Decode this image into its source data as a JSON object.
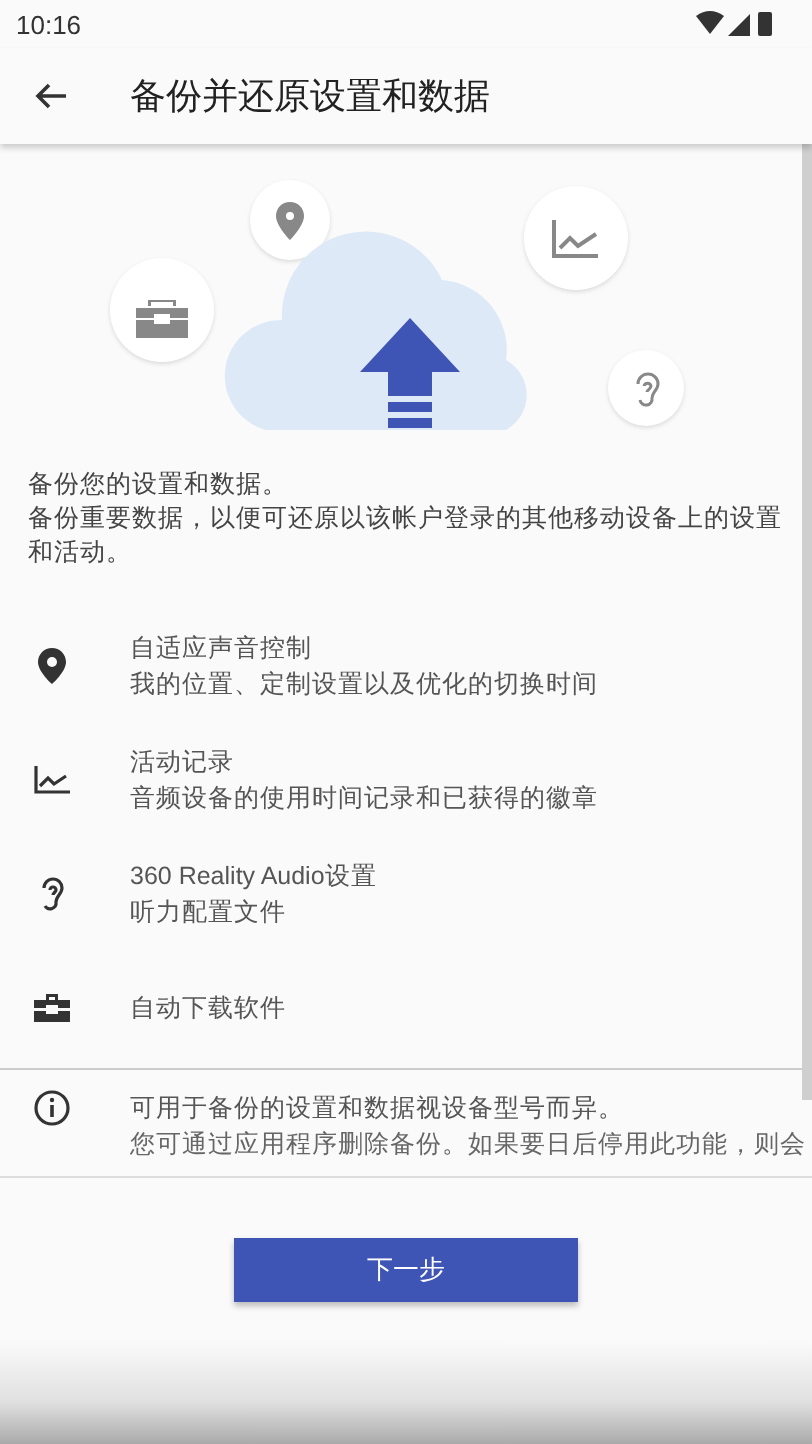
{
  "status_bar": {
    "time": "10:16"
  },
  "app_bar": {
    "title": "备份并还原设置和数据"
  },
  "intro": {
    "heading": "备份您的设置和数据。",
    "body": "备份重要数据，以便可还原以该帐户登录的其他移动设备上的设置和活动。"
  },
  "items": [
    {
      "kind": "location",
      "title": "自适应声音控制",
      "subtitle": "我的位置、定制设置以及优化的切换时间"
    },
    {
      "kind": "activity",
      "title": "活动记录",
      "subtitle": "音频设备的使用时间记录和已获得的徽章"
    },
    {
      "kind": "ear",
      "title": "360 Reality Audio设置",
      "subtitle": "听力配置文件"
    },
    {
      "kind": "software",
      "title": "自动下载软件"
    }
  ],
  "notes": [
    "可用于备份的设置和数据视设备型号而异。",
    "您可通过应用程序删除备份。如果要日后停用此功能，则会"
  ],
  "next_button": "下一步"
}
